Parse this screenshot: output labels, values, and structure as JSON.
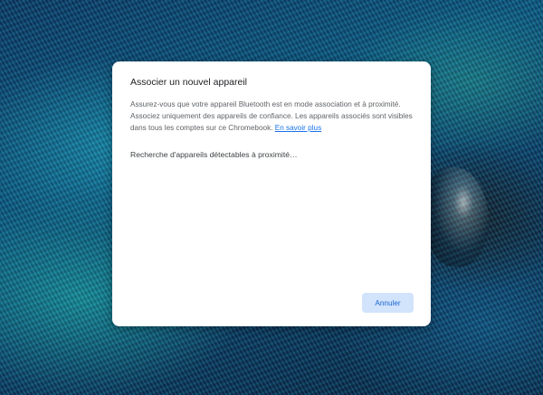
{
  "dialog": {
    "title": "Associer un nouvel appareil",
    "description": "Assurez-vous que votre appareil Bluetooth est en mode association et à proximité. Associez uniquement des appareils de confiance. Les appareils associés sont visibles dans tous les comptes sur ce Chromebook.",
    "learn_more_label": "En savoir plus",
    "status_text": "Recherche d'appareils détectables à proximité…",
    "cancel_label": "Annuler"
  },
  "colors": {
    "accent": "#1a73e8",
    "cancel_bg": "#d2e3fc",
    "cancel_text": "#1967d2"
  }
}
